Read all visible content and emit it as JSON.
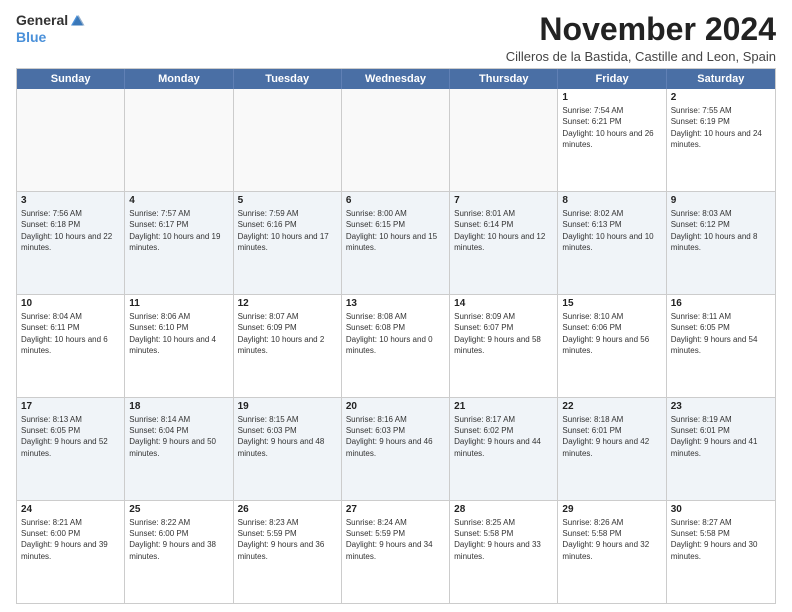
{
  "logo": {
    "text1": "General",
    "text2": "Blue"
  },
  "title": "November 2024",
  "location": "Cilleros de la Bastida, Castille and Leon, Spain",
  "header_days": [
    "Sunday",
    "Monday",
    "Tuesday",
    "Wednesday",
    "Thursday",
    "Friday",
    "Saturday"
  ],
  "weeks": [
    [
      {
        "day": "",
        "info": ""
      },
      {
        "day": "",
        "info": ""
      },
      {
        "day": "",
        "info": ""
      },
      {
        "day": "",
        "info": ""
      },
      {
        "day": "",
        "info": ""
      },
      {
        "day": "1",
        "info": "Sunrise: 7:54 AM\nSunset: 6:21 PM\nDaylight: 10 hours and 26 minutes."
      },
      {
        "day": "2",
        "info": "Sunrise: 7:55 AM\nSunset: 6:19 PM\nDaylight: 10 hours and 24 minutes."
      }
    ],
    [
      {
        "day": "3",
        "info": "Sunrise: 7:56 AM\nSunset: 6:18 PM\nDaylight: 10 hours and 22 minutes."
      },
      {
        "day": "4",
        "info": "Sunrise: 7:57 AM\nSunset: 6:17 PM\nDaylight: 10 hours and 19 minutes."
      },
      {
        "day": "5",
        "info": "Sunrise: 7:59 AM\nSunset: 6:16 PM\nDaylight: 10 hours and 17 minutes."
      },
      {
        "day": "6",
        "info": "Sunrise: 8:00 AM\nSunset: 6:15 PM\nDaylight: 10 hours and 15 minutes."
      },
      {
        "day": "7",
        "info": "Sunrise: 8:01 AM\nSunset: 6:14 PM\nDaylight: 10 hours and 12 minutes."
      },
      {
        "day": "8",
        "info": "Sunrise: 8:02 AM\nSunset: 6:13 PM\nDaylight: 10 hours and 10 minutes."
      },
      {
        "day": "9",
        "info": "Sunrise: 8:03 AM\nSunset: 6:12 PM\nDaylight: 10 hours and 8 minutes."
      }
    ],
    [
      {
        "day": "10",
        "info": "Sunrise: 8:04 AM\nSunset: 6:11 PM\nDaylight: 10 hours and 6 minutes."
      },
      {
        "day": "11",
        "info": "Sunrise: 8:06 AM\nSunset: 6:10 PM\nDaylight: 10 hours and 4 minutes."
      },
      {
        "day": "12",
        "info": "Sunrise: 8:07 AM\nSunset: 6:09 PM\nDaylight: 10 hours and 2 minutes."
      },
      {
        "day": "13",
        "info": "Sunrise: 8:08 AM\nSunset: 6:08 PM\nDaylight: 10 hours and 0 minutes."
      },
      {
        "day": "14",
        "info": "Sunrise: 8:09 AM\nSunset: 6:07 PM\nDaylight: 9 hours and 58 minutes."
      },
      {
        "day": "15",
        "info": "Sunrise: 8:10 AM\nSunset: 6:06 PM\nDaylight: 9 hours and 56 minutes."
      },
      {
        "day": "16",
        "info": "Sunrise: 8:11 AM\nSunset: 6:05 PM\nDaylight: 9 hours and 54 minutes."
      }
    ],
    [
      {
        "day": "17",
        "info": "Sunrise: 8:13 AM\nSunset: 6:05 PM\nDaylight: 9 hours and 52 minutes."
      },
      {
        "day": "18",
        "info": "Sunrise: 8:14 AM\nSunset: 6:04 PM\nDaylight: 9 hours and 50 minutes."
      },
      {
        "day": "19",
        "info": "Sunrise: 8:15 AM\nSunset: 6:03 PM\nDaylight: 9 hours and 48 minutes."
      },
      {
        "day": "20",
        "info": "Sunrise: 8:16 AM\nSunset: 6:03 PM\nDaylight: 9 hours and 46 minutes."
      },
      {
        "day": "21",
        "info": "Sunrise: 8:17 AM\nSunset: 6:02 PM\nDaylight: 9 hours and 44 minutes."
      },
      {
        "day": "22",
        "info": "Sunrise: 8:18 AM\nSunset: 6:01 PM\nDaylight: 9 hours and 42 minutes."
      },
      {
        "day": "23",
        "info": "Sunrise: 8:19 AM\nSunset: 6:01 PM\nDaylight: 9 hours and 41 minutes."
      }
    ],
    [
      {
        "day": "24",
        "info": "Sunrise: 8:21 AM\nSunset: 6:00 PM\nDaylight: 9 hours and 39 minutes."
      },
      {
        "day": "25",
        "info": "Sunrise: 8:22 AM\nSunset: 6:00 PM\nDaylight: 9 hours and 38 minutes."
      },
      {
        "day": "26",
        "info": "Sunrise: 8:23 AM\nSunset: 5:59 PM\nDaylight: 9 hours and 36 minutes."
      },
      {
        "day": "27",
        "info": "Sunrise: 8:24 AM\nSunset: 5:59 PM\nDaylight: 9 hours and 34 minutes."
      },
      {
        "day": "28",
        "info": "Sunrise: 8:25 AM\nSunset: 5:58 PM\nDaylight: 9 hours and 33 minutes."
      },
      {
        "day": "29",
        "info": "Sunrise: 8:26 AM\nSunset: 5:58 PM\nDaylight: 9 hours and 32 minutes."
      },
      {
        "day": "30",
        "info": "Sunrise: 8:27 AM\nSunset: 5:58 PM\nDaylight: 9 hours and 30 minutes."
      }
    ]
  ]
}
